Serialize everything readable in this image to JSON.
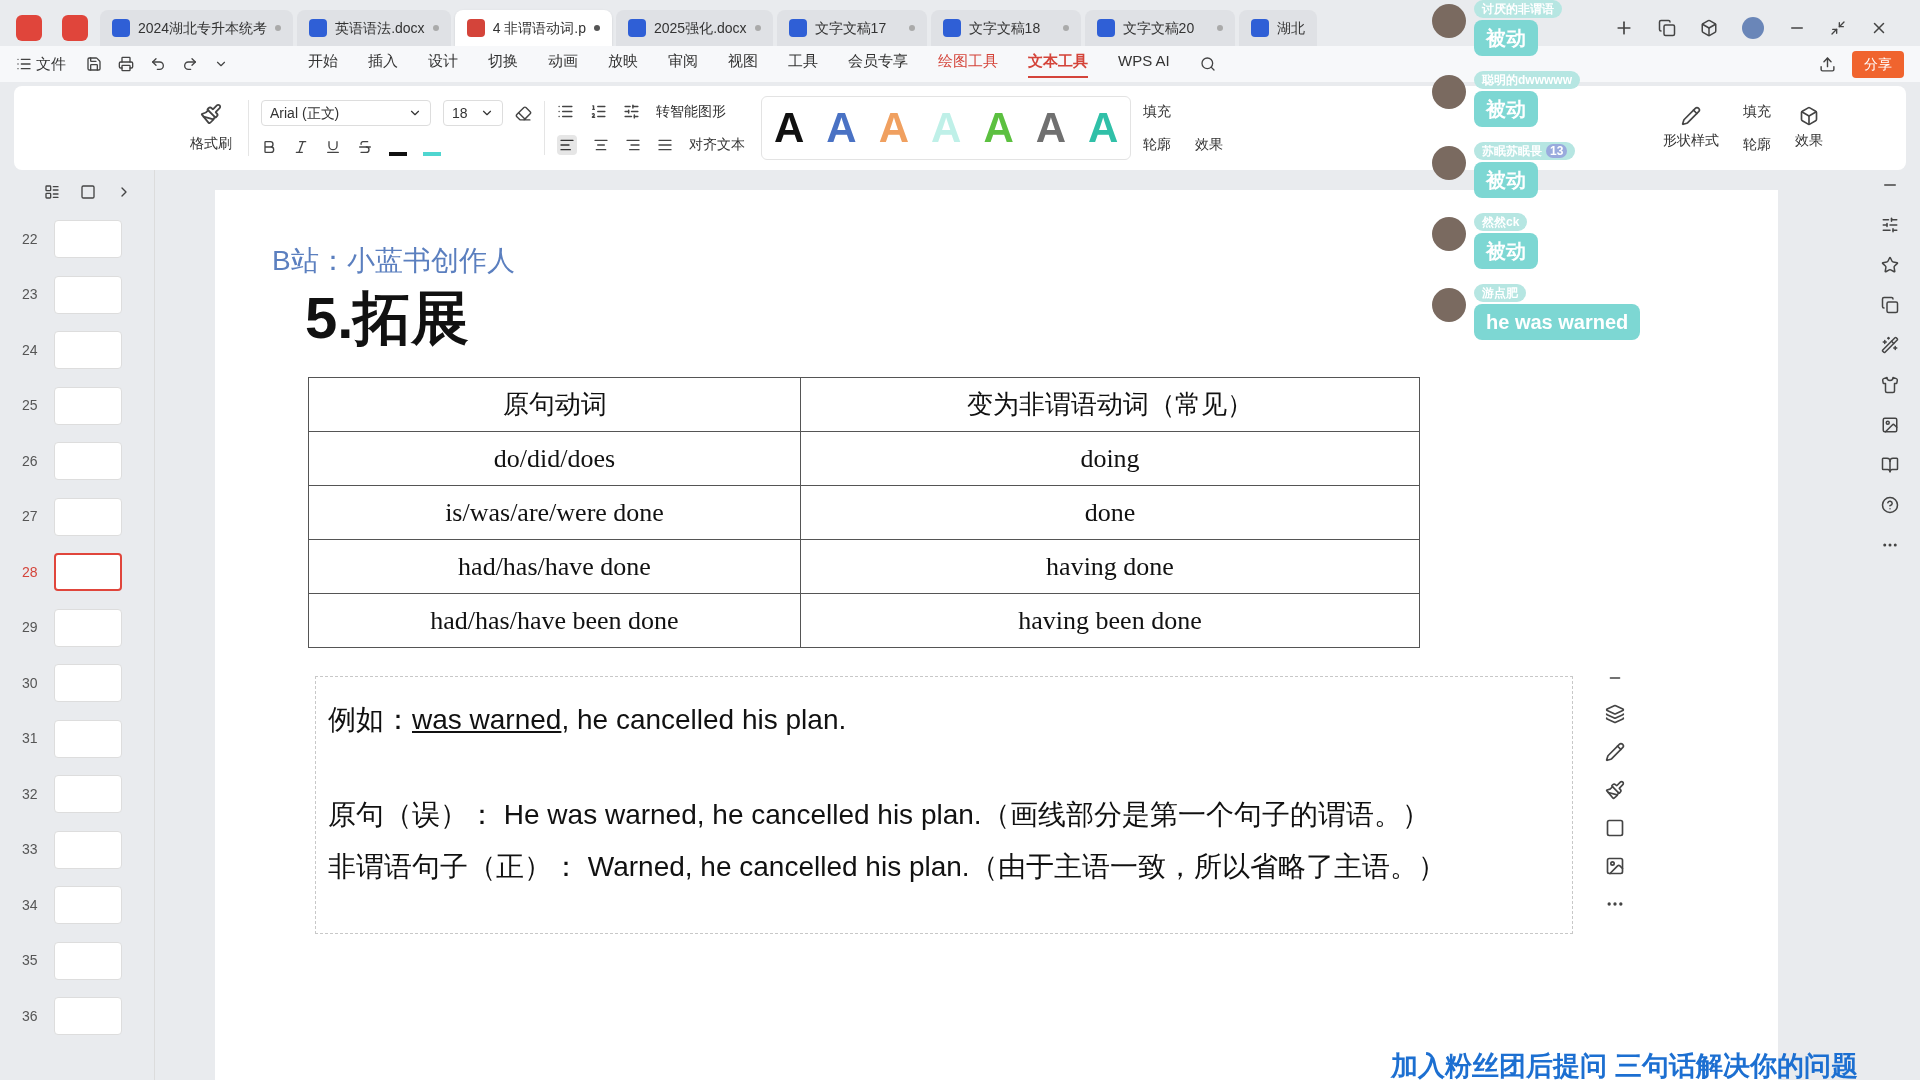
{
  "tabs": [
    {
      "label": "2024湖北专升本统考",
      "kind": "word",
      "selected": false
    },
    {
      "label": "英语语法.docx",
      "kind": "word",
      "selected": false
    },
    {
      "label": "4 非谓语动词.p",
      "kind": "ppt",
      "selected": true
    },
    {
      "label": "2025强化.docx",
      "kind": "word",
      "selected": false
    },
    {
      "label": "文字文稿17",
      "kind": "word",
      "selected": false
    },
    {
      "label": "文字文稿18",
      "kind": "word",
      "selected": false
    },
    {
      "label": "文字文稿20",
      "kind": "word",
      "selected": false
    },
    {
      "label": "湖北",
      "kind": "word",
      "selected": false
    }
  ],
  "menu": {
    "file": "文件",
    "items": [
      {
        "label": "开始",
        "selected": false,
        "kind": "normal"
      },
      {
        "label": "插入",
        "selected": false,
        "kind": "normal"
      },
      {
        "label": "设计",
        "selected": false,
        "kind": "normal"
      },
      {
        "label": "切换",
        "selected": false,
        "kind": "normal"
      },
      {
        "label": "动画",
        "selected": false,
        "kind": "normal"
      },
      {
        "label": "放映",
        "selected": false,
        "kind": "normal"
      },
      {
        "label": "审阅",
        "selected": false,
        "kind": "normal"
      },
      {
        "label": "视图",
        "selected": false,
        "kind": "normal"
      },
      {
        "label": "工具",
        "selected": false,
        "kind": "normal"
      },
      {
        "label": "会员专享",
        "selected": false,
        "kind": "normal"
      },
      {
        "label": "绘图工具",
        "selected": false,
        "kind": "context"
      },
      {
        "label": "文本工具",
        "selected": true,
        "kind": "context"
      },
      {
        "label": "WPS AI",
        "selected": false,
        "kind": "ai"
      }
    ],
    "share": "分享"
  },
  "ribbon": {
    "format_painter": "格式刷",
    "font": "Arial (正文)",
    "size": "18",
    "smart_shape": "转智能图形",
    "align_text": "对齐文本",
    "art_styles": [
      {
        "letter": "A",
        "color": "#111111"
      },
      {
        "letter": "A",
        "color": "#4a72c4"
      },
      {
        "letter": "A",
        "color": "#f0a060"
      },
      {
        "letter": "A",
        "color": "#bff0e8"
      },
      {
        "letter": "A",
        "color": "#5cc040"
      },
      {
        "letter": "A",
        "color": "#707070"
      },
      {
        "letter": "A",
        "color": "#30c0a8"
      }
    ],
    "text_fill": "填充",
    "text_outline": "轮廓",
    "text_effect": "效果",
    "shape_style": "形状样式",
    "shape_fill": "填充",
    "shape_outline": "轮廓",
    "shape_effect": "效果"
  },
  "slides": [
    {
      "number": "22",
      "selected": false
    },
    {
      "number": "23",
      "selected": false
    },
    {
      "number": "24",
      "selected": false
    },
    {
      "number": "25",
      "selected": false
    },
    {
      "number": "26",
      "selected": false
    },
    {
      "number": "27",
      "selected": false
    },
    {
      "number": "28",
      "selected": true
    },
    {
      "number": "29",
      "selected": false
    },
    {
      "number": "30",
      "selected": false
    },
    {
      "number": "31",
      "selected": false
    },
    {
      "number": "32",
      "selected": false
    },
    {
      "number": "33",
      "selected": false
    },
    {
      "number": "34",
      "selected": false
    },
    {
      "number": "35",
      "selected": false
    },
    {
      "number": "36",
      "selected": false
    }
  ],
  "slide": {
    "credit": "B站：小蓝书创作人",
    "title": "5.拓展",
    "table": {
      "columns": [
        "原句动词",
        "变为非谓语动词（常见）"
      ],
      "rows": [
        [
          "do/did/does",
          "doing"
        ],
        [
          "is/was/are/were done",
          "done"
        ],
        [
          "had/has/have done",
          "having done"
        ],
        [
          "had/has/have been done",
          "having been done"
        ]
      ]
    },
    "example": {
      "label": "例如：",
      "underlined": "was warned",
      "rest": ", he cancelled his plan."
    },
    "lines": [
      "原句（误）：  He was warned, he cancelled his plan.（画线部分是第一个句子的谓语。）",
      "非谓语句子（正）：  Warned, he cancelled his plan.（由于主语一致，所以省略了主语。）"
    ]
  },
  "caption": "加入粉丝团后提问 三句话解决你的问题",
  "chat": [
    {
      "name": "讨厌的非谓语",
      "message": "被动"
    },
    {
      "name": "聪明的dwwwww",
      "message": "被动"
    },
    {
      "name": "苏眠苏眠畏",
      "badge": "13",
      "message": "被动"
    },
    {
      "name": "然然ck",
      "message": "被动"
    },
    {
      "name": "游点肥",
      "message": "he was warned"
    }
  ]
}
